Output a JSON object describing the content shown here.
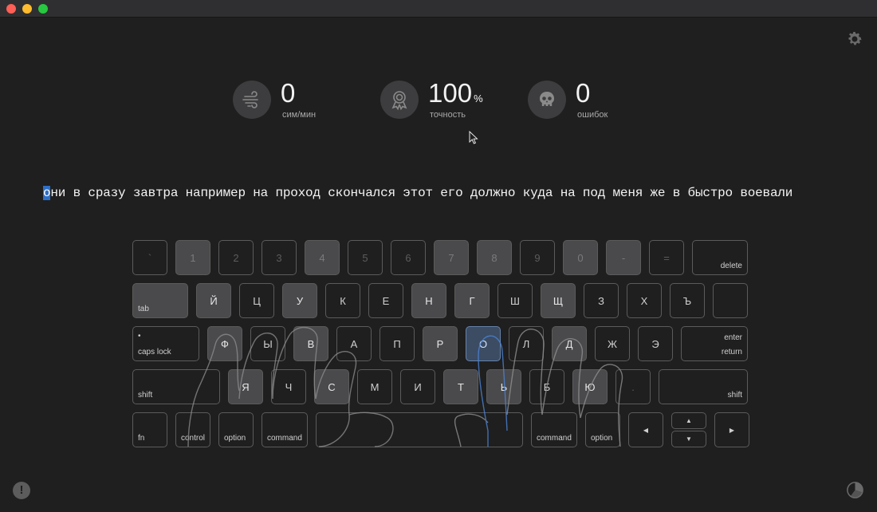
{
  "window": {
    "controls": [
      "close",
      "minimize",
      "zoom"
    ]
  },
  "icons": {
    "settings": "gear-icon",
    "info": "info-icon",
    "stats": "pie-chart-icon",
    "speed": "wind-icon",
    "accuracy": "award-ribbon-icon",
    "errors": "skull-icon"
  },
  "stats": {
    "speed": {
      "value": "0",
      "label": "сим/мин"
    },
    "accuracy": {
      "value": "100",
      "unit": "%",
      "label": "точность"
    },
    "errors": {
      "value": "0",
      "label": "ошибок"
    }
  },
  "info_label": "!",
  "typing": {
    "current_char": "о",
    "rest": "ни в сразу завтра например на проход скончался этот его должно куда на под меня же в быстро воевали"
  },
  "keyboard": {
    "row0": [
      "`",
      "1",
      "2",
      "3",
      "4",
      "5",
      "6",
      "7",
      "8",
      "9",
      "0",
      "-",
      "="
    ],
    "delete": "delete",
    "tab": "tab",
    "row1": [
      "Й",
      "Ц",
      "У",
      "К",
      "Е",
      "Н",
      "Г",
      "Ш",
      "Щ",
      "З",
      "Х",
      "Ъ"
    ],
    "caps_dot": "•",
    "caps": "caps lock",
    "row2": [
      "Ф",
      "Ы",
      "В",
      "А",
      "П",
      "Р",
      "О",
      "Л",
      "Д",
      "Ж",
      "Э"
    ],
    "enter": "enter",
    "return": "return",
    "shift": "shift",
    "row3": [
      "Я",
      "Ч",
      "С",
      "М",
      "И",
      "Т",
      "Ь",
      "Б",
      "Ю",
      "."
    ],
    "fn": "fn",
    "control": "control",
    "option": "option",
    "command": "command",
    "arrow_left": "◀",
    "arrow_up": "▲",
    "arrow_down": "▼",
    "arrow_right": "▶"
  },
  "colors": {
    "background": "#1f1f1f",
    "accent": "#2d6fc7",
    "key_highlight": "#4a4a4d"
  }
}
